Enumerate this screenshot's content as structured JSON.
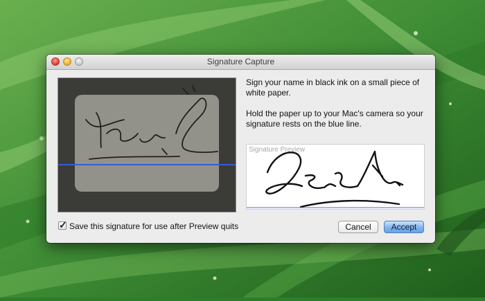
{
  "window": {
    "title": "Signature Capture"
  },
  "instructions": {
    "line1": "Sign your name in black ink on a small piece of white paper.",
    "line2": "Hold the paper up to your Mac's camera so your signature rests on the blue line."
  },
  "preview": {
    "label": "Signature Preview"
  },
  "options": {
    "save_label": "Save this signature for use after Preview quits",
    "save_checked": true
  },
  "buttons": {
    "cancel": "Cancel",
    "accept": "Accept"
  },
  "colors": {
    "baseline": "#3b5bd6",
    "accent_button": "#6aa4e6",
    "ink": "#111111"
  },
  "icons": {
    "checkbox": "checkmark-icon"
  }
}
